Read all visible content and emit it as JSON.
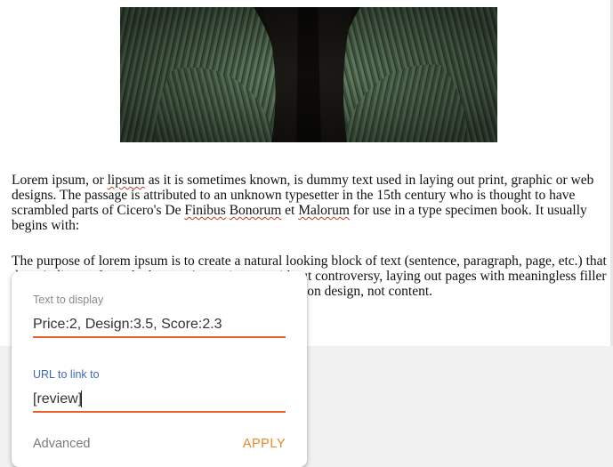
{
  "document": {
    "hero_image": {
      "icon": "sweater-photo",
      "colors": {
        "knit": "#4f6b4f",
        "shadow": "#141410"
      }
    },
    "paragraph1": {
      "t1": "Lorem ipsum, or ",
      "w1": "lipsum",
      "t2": " as it is sometimes known, is dummy text used in laying out print, graphic or web designs. The passage is attributed to an unknown typesetter in the 15th century who is thought to have scrambled parts of Cicero's De ",
      "w2": "Finibus",
      "t3": " ",
      "w3": "Bonorum",
      "t4": " et ",
      "w4": "Malorum",
      "t5": " for use in a type specimen book. It usually begins with:"
    },
    "paragraph2": "The purpose of lorem ipsum is to create a natural looking block of text (sentence, paragraph, page, etc.) that doesn't distract from the layout. A practice not without controversy, laying out pages with meaningless filler text can be very useful when the focus is meant to be on design, not content."
  },
  "link_dialog": {
    "text_label": "Text to display",
    "text_value": "Price:2, Design:3.5, Score:2.3",
    "url_label": "URL to link to",
    "url_value": "[review]",
    "advanced_label": "Advanced",
    "apply_label": "APPLY",
    "colors": {
      "accent": "#e8602c",
      "apply": "#e8862c",
      "active_label": "#3d6bb3"
    }
  }
}
